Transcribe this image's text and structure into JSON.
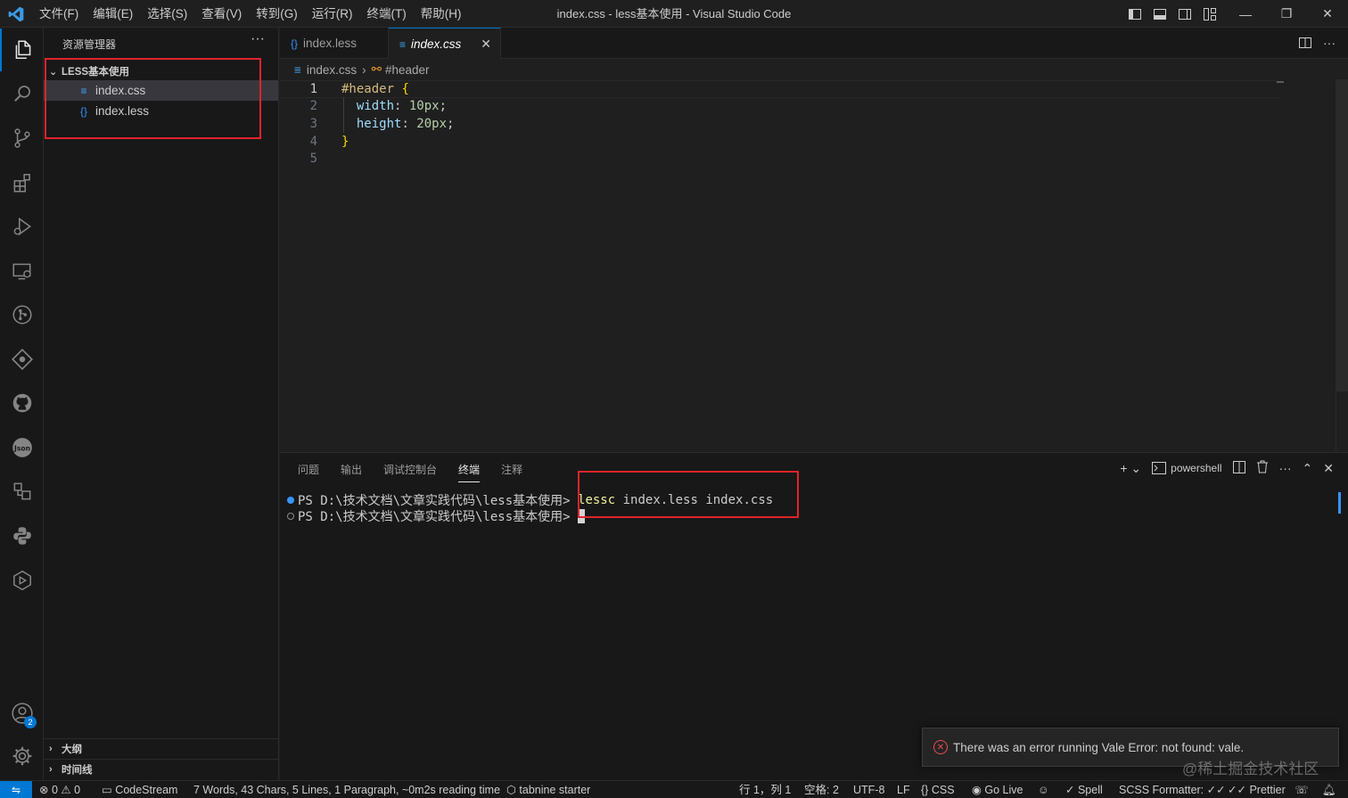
{
  "window": {
    "title": "index.css - less基本使用 - Visual Studio Code",
    "menu": [
      "文件(F)",
      "编辑(E)",
      "选择(S)",
      "查看(V)",
      "转到(G)",
      "运行(R)",
      "终端(T)",
      "帮助(H)"
    ],
    "layout_icons": [
      "toggle-primary-sidebar-icon",
      "toggle-panel-icon",
      "toggle-secondary-sidebar-icon",
      "customize-layout-icon"
    ],
    "controls": {
      "minimize": "—",
      "restore": "❐",
      "close": "✕"
    }
  },
  "activity_bar": {
    "items": [
      "explorer",
      "search",
      "source-control",
      "extensions",
      "run-debug",
      "remote-explorer",
      "git-graph",
      "gitlens",
      "github",
      "json",
      "live-share",
      "python",
      "testing"
    ],
    "accounts_badge": "2"
  },
  "sidebar": {
    "title": "资源管理器",
    "folder": "LESS基本使用",
    "files": [
      {
        "name": "index.css",
        "icon": "css-file-icon",
        "selected": true
      },
      {
        "name": "index.less",
        "icon": "less-file-icon",
        "selected": false
      }
    ],
    "outline_label": "大纲",
    "timeline_label": "时间线"
  },
  "tabs": [
    {
      "label": "index.less",
      "icon": "{}",
      "active": false
    },
    {
      "label": "index.css",
      "icon": "≡",
      "active": true
    }
  ],
  "breadcrumb": {
    "file": "index.css",
    "symbol": "#header"
  },
  "editor": {
    "line_numbers": [
      "1",
      "2",
      "3",
      "4",
      "5"
    ],
    "code": {
      "selector": "#header",
      "open_brace": "{",
      "width_prop": "width",
      "width_value": "10px",
      "height_prop": "height",
      "height_value": "20px",
      "close_brace": "}"
    }
  },
  "panel": {
    "tabs": [
      "问题",
      "输出",
      "调试控制台",
      "终端",
      "注释"
    ],
    "active_tab": "终端",
    "terminal_name": "powershell",
    "terminal_lines": [
      {
        "prompt": "PS D:\\技术文档\\文章实践代码\\less基本使用> ",
        "command_keyword": "lessc",
        "command_args": " index.less index.css"
      },
      {
        "prompt": "PS D:\\技术文档\\文章实践代码\\less基本使用> "
      }
    ]
  },
  "notification": {
    "message": "There was an error running Vale Error: not found: vale."
  },
  "watermark": "@稀土掘金技术社区",
  "status_bar": {
    "errors": "0",
    "warnings": "0",
    "codestream": "CodeStream",
    "word_count": "7 Words, 43 Chars, 5 Lines, 1 Paragraph, ~0m2s reading time",
    "tabnine": "tabnine starter",
    "cursor_pos": "行 1，列 1",
    "indent": "空格: 2",
    "encoding": "UTF-8",
    "eol": "LF",
    "language": "CSS",
    "go_live": "Go Live",
    "spell": "Spell",
    "scss_formatter": "SCSS Formatter:",
    "prettier": "Prettier"
  },
  "colors": {
    "accent": "#0078d4",
    "highlight_box": "#e0242b",
    "error": "#f14c4c"
  }
}
